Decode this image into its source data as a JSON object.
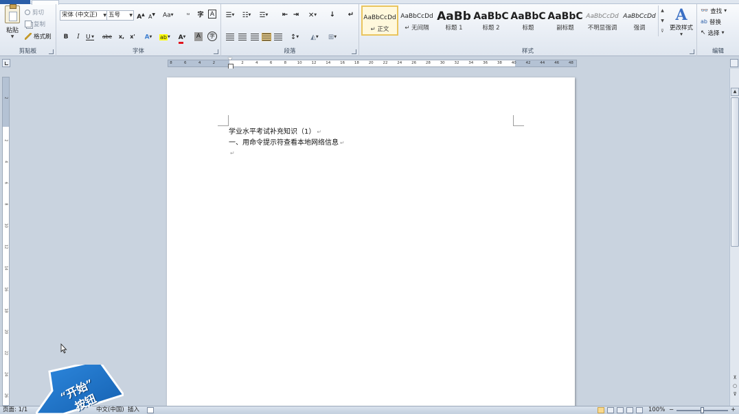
{
  "ribbon": {
    "clipboard": {
      "paste_label": "粘贴",
      "cut_label": "剪切",
      "copy_label": "复制",
      "format_painter_label": "格式刷",
      "group_label": "剪贴板"
    },
    "font": {
      "font_name": "宋体 (中文正)",
      "font_size": "五号",
      "grow_label": "A",
      "shrink_label": "A",
      "change_case_label": "Aa",
      "clear_format_label": "A",
      "bold_label": "B",
      "italic_label": "I",
      "underline_label": "U",
      "strike_label": "abe",
      "subscript_label": "x,",
      "superscript_label": "x'",
      "font_color_label": "A",
      "char_shading_label": "A",
      "enclose_label": "字",
      "phonetic_label": "wén",
      "border_label": "A",
      "group_label": "字体"
    },
    "paragraph": {
      "group_label": "段落"
    },
    "styles": {
      "group_label": "样式",
      "items": [
        {
          "sample": "AaBbCcDd",
          "name": "↵ 正文",
          "selected": true
        },
        {
          "sample": "AaBbCcDd",
          "name": "↵ 无间隔",
          "selected": false
        },
        {
          "sample": "AaBb",
          "name": "标题 1",
          "selected": false
        },
        {
          "sample": "AaBbC",
          "name": "标题 2",
          "selected": false
        },
        {
          "sample": "AaBbC",
          "name": "标题",
          "selected": false
        },
        {
          "sample": "AaBbC",
          "name": "副标题",
          "selected": false
        },
        {
          "sample": "AaBbCcDd",
          "name": "不明显强调",
          "selected": false
        },
        {
          "sample": "AaBbCcDd",
          "name": "强调",
          "selected": false
        }
      ],
      "change_styles_label": "更改样式",
      "change_styles_icon": "A"
    },
    "editing": {
      "find_label": "查找",
      "replace_label": "替换",
      "select_label": "选择",
      "group_label": "编辑"
    }
  },
  "ruler": {
    "ticks": [
      "8",
      "6",
      "4",
      "2",
      "",
      "2",
      "4",
      "6",
      "8",
      "10",
      "12",
      "14",
      "16",
      "18",
      "20",
      "22",
      "24",
      "26",
      "28",
      "30",
      "32",
      "34",
      "36",
      "38",
      "40",
      "42",
      "44",
      "46",
      "48"
    ],
    "v_ticks": [
      "2",
      "",
      "2",
      "4",
      "6",
      "8",
      "10",
      "12",
      "14",
      "16",
      "18",
      "20",
      "22",
      "24",
      "26"
    ]
  },
  "document": {
    "line1": "学业水平考试补充知识（1）",
    "line2": "一、用命令提示符查看本地网络信息",
    "para_mark": "↵"
  },
  "status_bar": {
    "page": "页面: 1/1",
    "language": "中文(中国)",
    "insert_mode": "插入",
    "zoom": "100%",
    "zoom_out": "−",
    "zoom_in": "+"
  },
  "overlay": {
    "line1": "“开始”",
    "line2": "按钮"
  },
  "colors": {
    "accent": "#2a5ea8",
    "selected_style_border": "#e9c45d",
    "badge_blue": "#1d6fc0"
  }
}
